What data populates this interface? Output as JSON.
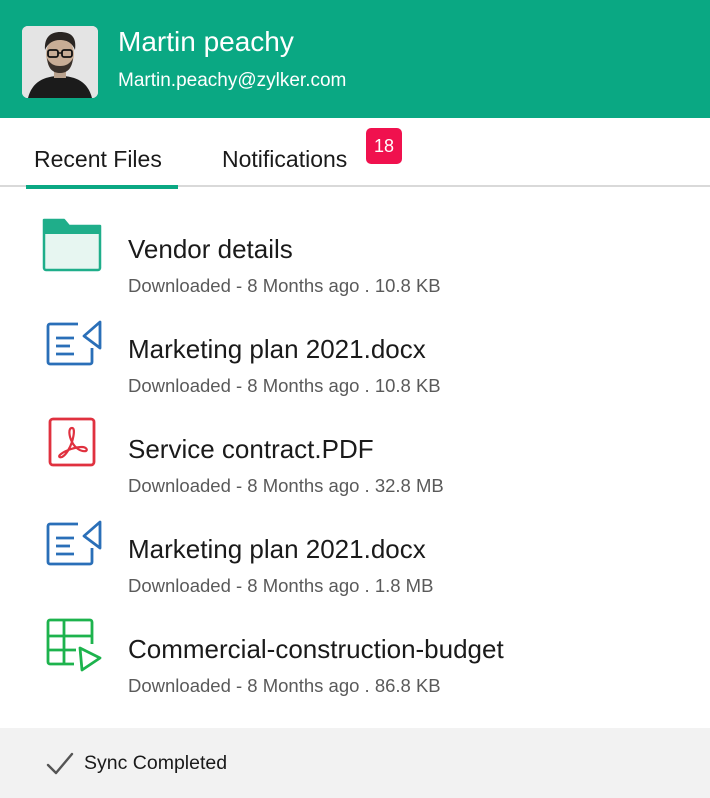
{
  "user": {
    "name": "Martin peachy",
    "email": "Martin.peachy@zylker.com"
  },
  "tabs": [
    {
      "label": "Recent Files",
      "active": true
    },
    {
      "label": "Notifications",
      "badge": "18"
    }
  ],
  "files": [
    {
      "name": "Vendor details",
      "meta": "Downloaded - 8 Months ago . 10.8 KB",
      "icon": "folder-icon",
      "color": "#1fae8a"
    },
    {
      "name": "Marketing plan 2021.docx",
      "meta": "Downloaded - 8 Months ago . 10.8 KB",
      "icon": "document-icon",
      "color": "#2a6fb8"
    },
    {
      "name": "Service contract.PDF",
      "meta": "Downloaded - 8 Months ago . 32.8 MB",
      "icon": "pdf-icon",
      "color": "#e0313f"
    },
    {
      "name": "Marketing plan 2021.docx",
      "meta": "Downloaded - 8 Months ago . 1.8 MB",
      "icon": "document-icon",
      "color": "#2a6fb8"
    },
    {
      "name": "Commercial-construction-budget",
      "meta": "Downloaded - 8 Months ago . 86.8 KB",
      "icon": "spreadsheet-icon",
      "color": "#1db34d"
    }
  ],
  "footer": {
    "status": "Sync Completed",
    "icon": "check-icon"
  },
  "colors": {
    "accent": "#0aa883",
    "badge": "#f0114e",
    "footer_bg": "#f2f2f2"
  }
}
